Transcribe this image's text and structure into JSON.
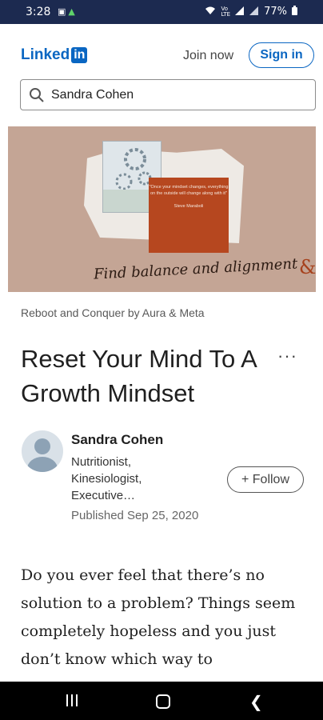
{
  "status_bar": {
    "time": "3:28",
    "left_icons": [
      "image-icon",
      "alert-icon"
    ],
    "right_icons": [
      "wifi-icon",
      "volte-icon",
      "signal-icon",
      "signal-icon"
    ],
    "battery": "77%"
  },
  "header": {
    "logo_text": "Linked",
    "logo_box": "in",
    "join_label": "Join now",
    "signin_label": "Sign in",
    "brand_color": "#0a66c2"
  },
  "search": {
    "icon": "search-icon",
    "value": "Sandra Cohen"
  },
  "hero": {
    "quote": "\"Once your mindset changes, everything on the outside will change along with it\"",
    "quote_author": "Steve Maraboli",
    "script_text": "Find balance and alignment",
    "corner_mark": "&"
  },
  "article": {
    "series": "Reboot and Conquer by Aura & Meta",
    "title": "Reset Your Mind To A Growth Mindset",
    "more_label": "···",
    "author": {
      "name": "Sandra Cohen",
      "headline": "Nutritionist,\nKinesiologist,\nExecutive…",
      "published": "Published Sep 25, 2020",
      "follow_label": "+ Follow"
    },
    "body": "Do you ever feel that there’s no solution to a problem? Things seem completely hopeless and you just don’t know which way to"
  },
  "nav_bar": {
    "icons": [
      "recent-apps-icon",
      "home-icon",
      "back-icon"
    ]
  }
}
